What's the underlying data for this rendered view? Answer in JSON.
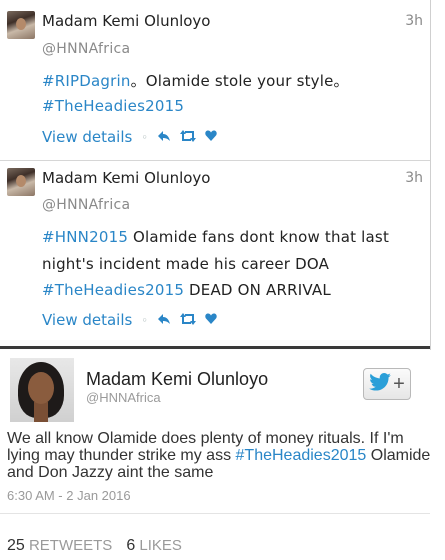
{
  "tweets": [
    {
      "name": "Madam Kemi Olunloyo",
      "handle": "@HNNAfrica",
      "time": "3h",
      "line1_tag": "#RIPDagrin",
      "line1_text": "。Olamide stole your style。",
      "line2_tag": "#TheHeadies2015",
      "details": "View details",
      "dot": "◦"
    },
    {
      "name": "Madam Kemi Olunloyo",
      "handle": "@HNNAfrica",
      "time": "3h",
      "line1_tag": "#HNN2015",
      "line1_text": " Olamide fans dont know that last",
      "line2_text": "night's incident made his career DOA",
      "line3_tag": "#TheHeadies2015",
      "line3_text": " DEAD ON ARRIVAL",
      "details": "View details",
      "dot": "◦"
    }
  ],
  "embed": {
    "name": "Madam Kemi Olunloyo",
    "handle": "@HNNAfrica",
    "follow_plus": "+",
    "text_before": "We all know Olamide does plenty of money rituals. If I'm lying may thunder strike my ass ",
    "text_tag": "#TheHeadies2015",
    "text_after": " Olamide and Don Jazzy aint the same",
    "date": "6:30 AM - 2 Jan 2016",
    "retweets_count": "25",
    "retweets_label": " RETWEETS",
    "likes_count": "6",
    "likes_label": " LIKES"
  },
  "colors": {
    "link": "#2a86c7",
    "twitter_blue": "#2a9fd8"
  }
}
